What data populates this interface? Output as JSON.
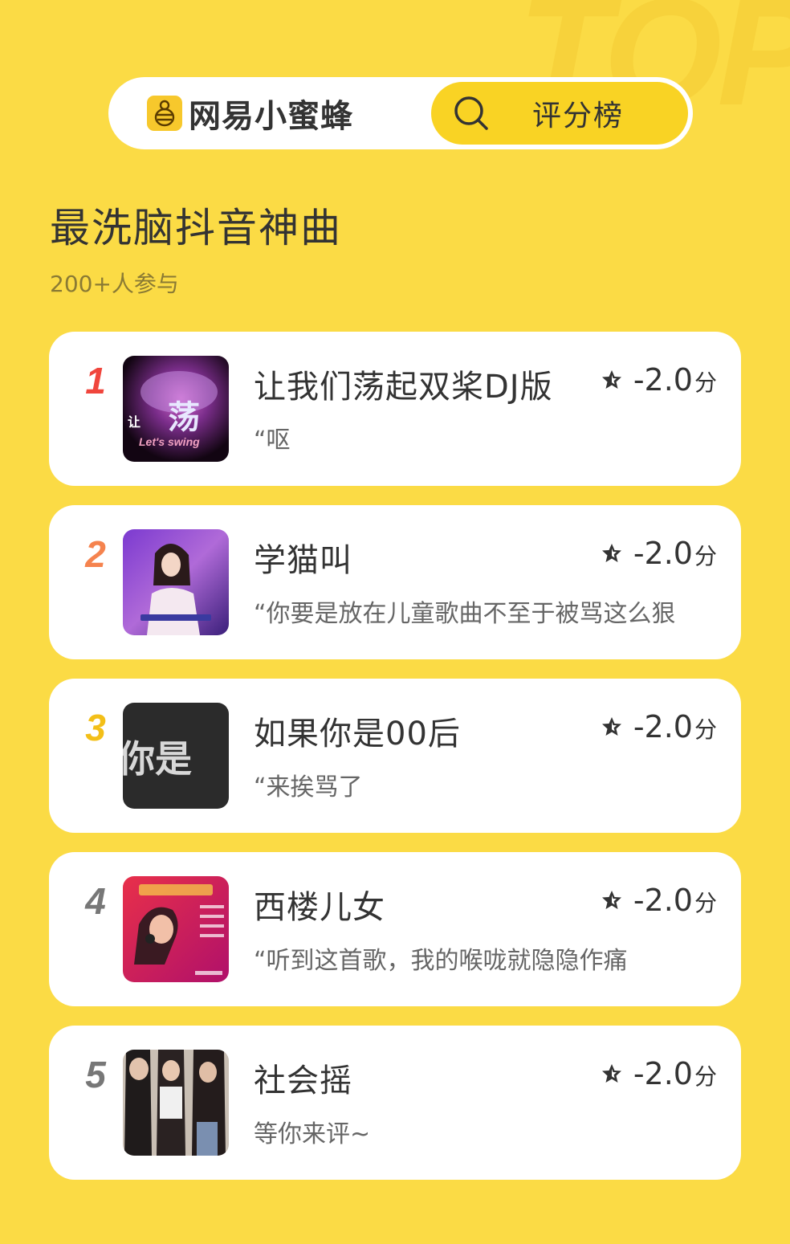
{
  "header": {
    "brand_name": "网易小蜜蜂",
    "search_label": "评分榜"
  },
  "decor": {
    "watermark": "TOP"
  },
  "board": {
    "title": "最洗脑抖音神曲",
    "participants": "200+人参与"
  },
  "items": [
    {
      "rank": "1",
      "rank_color": "#F0453C",
      "title": "让我们荡起双桨DJ版",
      "comment": "“呕",
      "score": "-2.0",
      "unit": "分",
      "thumb_icon": "album-cover-purple"
    },
    {
      "rank": "2",
      "rank_color": "#F5834E",
      "title": "学猫叫",
      "comment": "“你要是放在儿童歌曲不至于被骂这么狠",
      "score": "-2.0",
      "unit": "分",
      "thumb_icon": "album-cover-stage"
    },
    {
      "rank": "3",
      "rank_color": "#F3BF18",
      "title": "如果你是00后",
      "comment": "“来挨骂了",
      "score": "-2.0",
      "unit": "分",
      "thumb_icon": "album-cover-text"
    },
    {
      "rank": "4",
      "rank_color": "#777777",
      "title": "西楼儿女",
      "comment": "“听到这首歌，我的喉咙就隐隐作痛",
      "score": "-2.0",
      "unit": "分",
      "thumb_icon": "album-cover-singer"
    },
    {
      "rank": "5",
      "rank_color": "#777777",
      "title": "社会摇",
      "comment": "等你来评~",
      "score": "-2.0",
      "unit": "分",
      "thumb_icon": "album-cover-dancers"
    }
  ]
}
